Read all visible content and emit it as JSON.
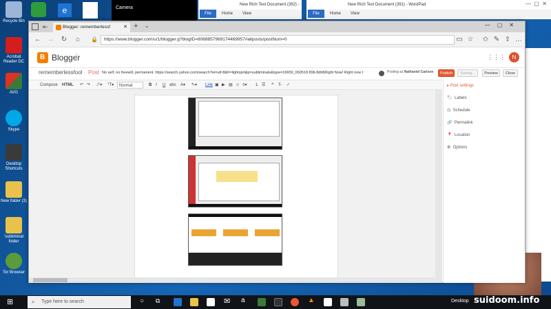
{
  "desktop": {
    "icons": [
      {
        "label": "Recycle Bin",
        "color": "#9bb6d6"
      },
      {
        "label": "Acrobat Reader DC",
        "color": "#d31e1e"
      },
      {
        "label": "AVG",
        "color": "#3b7a3b"
      },
      {
        "label": "Skype",
        "color": "#00a8e8"
      },
      {
        "label": "Desktop Shortcuts",
        "color": "#3a3a3a"
      },
      {
        "label": "New folder (3)",
        "color": "#e8c24a"
      },
      {
        "label": "'subliminal folder",
        "color": "#e8c24a"
      },
      {
        "label": "Tor Browser",
        "color": "#5c9b3a"
      }
    ],
    "camera_label": "Camera"
  },
  "wordpad1": {
    "title": "New Rich Text Document (392) - WordPad",
    "file": "File",
    "home": "Home",
    "view": "View"
  },
  "wordpad2": {
    "title": "New Rich Text Document (391) - WordPad",
    "file": "File",
    "home": "Home",
    "view": "View"
  },
  "browser": {
    "tab_title": "Blogger: rememberlessf",
    "url": "https://www.blogger.com/u/1/blogger.g?blogID=8068857969174469957#allposts/postNum=0"
  },
  "blogger": {
    "logo_text": "Blogger",
    "avatar_letter": "N",
    "blog_name": "rememberlessfool",
    "separator": "·",
    "post_word": "Post",
    "post_title": "No self, no freewill, permanent. https://search.yahoo.com/search?ei=utf-8&fr=lightsprt&p=subliminals&type=16659_060518 89b.8dbf|Right Now! Right now t",
    "posting_as_prefix": "Posting as",
    "posting_as_name": "Nathaniel Carlson",
    "publish": "Publish",
    "saving": "Saving...",
    "preview": "Preview",
    "close": "Close"
  },
  "toolbar": {
    "compose": "Compose",
    "html": "HTML",
    "format": "Normal",
    "link": "Link"
  },
  "sidebar": {
    "post_settings": "Post settings",
    "items": [
      "Labels",
      "Schedule",
      "Permalink",
      "Location",
      "Options"
    ]
  },
  "taskbar": {
    "search_placeholder": "Type here to search",
    "desktop_label": "Desktop",
    "watermark": "suidoom.info"
  }
}
